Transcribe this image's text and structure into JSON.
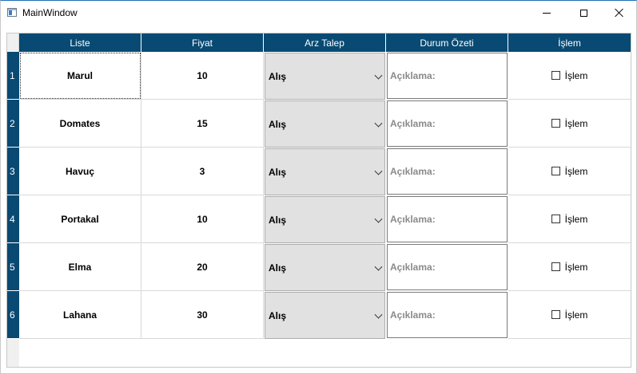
{
  "window": {
    "title": "MainWindow"
  },
  "table": {
    "headers": [
      "Liste",
      "Fiyat",
      "Arz Talep",
      "Durum Özeti",
      "İşlem"
    ],
    "rows": [
      {
        "num": "1",
        "liste": "Marul",
        "fiyat": "10",
        "arz_talep": "Alış",
        "durum_placeholder": "Açıklama:",
        "islem_label": "İşlem"
      },
      {
        "num": "2",
        "liste": "Domates",
        "fiyat": "15",
        "arz_talep": "Alış",
        "durum_placeholder": "Açıklama:",
        "islem_label": "İşlem"
      },
      {
        "num": "3",
        "liste": "Havuç",
        "fiyat": "3",
        "arz_talep": "Alış",
        "durum_placeholder": "Açıklama:",
        "islem_label": "İşlem"
      },
      {
        "num": "4",
        "liste": "Portakal",
        "fiyat": "10",
        "arz_talep": "Alış",
        "durum_placeholder": "Açıklama:",
        "islem_label": "İşlem"
      },
      {
        "num": "5",
        "liste": "Elma",
        "fiyat": "20",
        "arz_talep": "Alış",
        "durum_placeholder": "Açıklama:",
        "islem_label": "İşlem"
      },
      {
        "num": "6",
        "liste": "Lahana",
        "fiyat": "30",
        "arz_talep": "Alış",
        "durum_placeholder": "Açıklama:",
        "islem_label": "İşlem"
      }
    ]
  },
  "colors": {
    "header_bg": "#084a73",
    "combo_bg": "#e1e1e1"
  },
  "icons": {
    "app": "window-icon",
    "minimize": "minimize-icon",
    "maximize": "maximize-icon",
    "close": "close-icon",
    "dropdown": "chevron-down-icon",
    "checkbox": "checkbox-icon"
  }
}
